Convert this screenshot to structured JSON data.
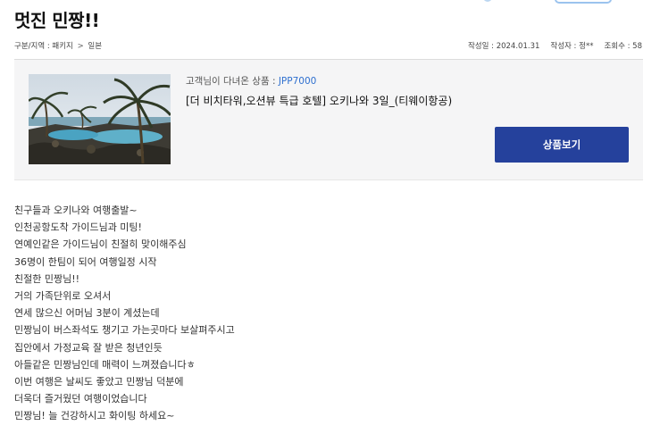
{
  "title": "멋진 민짱!!",
  "meta": {
    "category_label": "구분/지역 : 패키지",
    "category_sep": ">",
    "region": "일본",
    "date": "작성일 : 2024.01.31",
    "author": "작성자 : 정**",
    "views": "조회수 : 58"
  },
  "product": {
    "visited_label": "고객님이 다녀온 상품 : ",
    "code": "JPP7000",
    "name": "[더 비치타워,오션뷰 특급 호텔] 오키나와 3일_(티웨이항공)",
    "view_button": "상품보기"
  },
  "body_lines": [
    "친구들과 오키나와 여행출발~",
    "인천공항도착 가이드님과 미팅!",
    "연예인같은 가이드님이 친절히 맞이해주심",
    "36명이 한팀이 되어 여행일정 시작",
    "친절한 민짱님!!",
    "거의 가족단위로 오셔서",
    "연세 많으신 어머님 3분이 계셨는데",
    "민짱님이 버스좌석도 챙기고 가는곳마다  보살펴주시고",
    "집안에서 가정교육 잘 받은 청년인듯",
    "아들같은 민짱님인데 매력이 느껴졌습니다ㅎ",
    "이번 여행은 날씨도 좋았고 민짱님 덕분에",
    "더욱더 즐거웠던 여행이었습니다",
    "민짱님!  늘 건강하시고 화이팅 하세요~"
  ],
  "colors": {
    "accent_button": "#25419c",
    "product_code": "#2e6fcf",
    "box_background": "#f5f5f6"
  }
}
